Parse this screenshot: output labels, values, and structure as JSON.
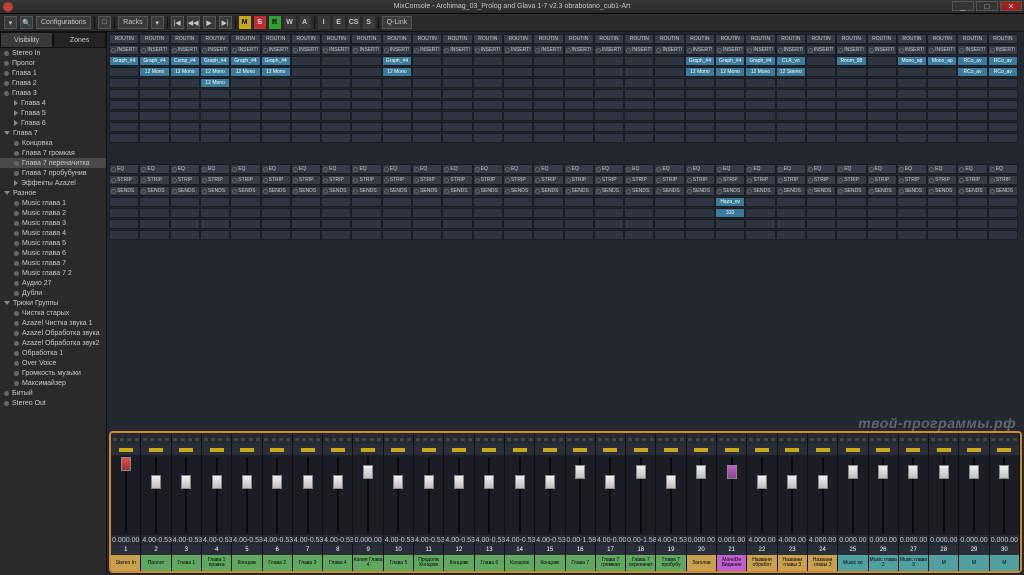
{
  "title": "MixConsole - Archimag_03_Prolog and Glava 1-7 v2.3 obrabotano_cub1-Art",
  "toolbar": {
    "config": "Configurations",
    "racks": "Racks",
    "qlink": "Q-Link"
  },
  "sidebar": {
    "tabs": [
      "Visibility",
      "Zones"
    ],
    "tracks": [
      {
        "name": "Stereo In",
        "dot": true
      },
      {
        "name": "Пролог",
        "dot": true
      },
      {
        "name": "Глава 1",
        "dot": true
      },
      {
        "name": "Глава 2",
        "dot": true
      },
      {
        "name": "Глава 3",
        "dot": true
      },
      {
        "name": "Глава 4",
        "tri": true,
        "indent": 1
      },
      {
        "name": "Глава 5",
        "tri": true,
        "indent": 1
      },
      {
        "name": "Глава 6",
        "tri": true,
        "indent": 1
      },
      {
        "name": "Глава 7",
        "tri": true,
        "open": true
      },
      {
        "name": "Концовка",
        "dot": true,
        "indent": 1
      },
      {
        "name": "Глава 7 громкая",
        "dot": true,
        "indent": 1
      },
      {
        "name": "Глава 7 переначитка",
        "dot": true,
        "indent": 1,
        "selected": true
      },
      {
        "name": "Глава 7 пробубунив",
        "dot": true,
        "indent": 1
      },
      {
        "name": "Эффекты Azazel",
        "tri": true,
        "indent": 1
      },
      {
        "name": "Разное",
        "tri": true,
        "open": true
      },
      {
        "name": "Music глава 1",
        "dot": true,
        "indent": 1
      },
      {
        "name": "Music глава 2",
        "dot": true,
        "indent": 1
      },
      {
        "name": "Music глава 3",
        "dot": true,
        "indent": 1
      },
      {
        "name": "Music глава 4",
        "dot": true,
        "indent": 1
      },
      {
        "name": "Music глава 5",
        "dot": true,
        "indent": 1
      },
      {
        "name": "Music глава 6",
        "dot": true,
        "indent": 1
      },
      {
        "name": "Music глава 7",
        "dot": true,
        "indent": 1
      },
      {
        "name": "Music глава 7 2",
        "dot": true,
        "indent": 1
      },
      {
        "name": "Аудио 27",
        "dot": true,
        "indent": 1
      },
      {
        "name": "Дубли",
        "dot": true,
        "indent": 1
      },
      {
        "name": "Трюки Группы",
        "tri": true,
        "open": true
      },
      {
        "name": "Чистка старых",
        "dot": true,
        "indent": 1
      },
      {
        "name": "Azazel Чистка звука 1",
        "dot": true,
        "indent": 1
      },
      {
        "name": "Azazel Обработка звука",
        "dot": true,
        "indent": 1
      },
      {
        "name": "Azazel Обработка звук2",
        "dot": true,
        "indent": 1
      },
      {
        "name": "Обработка 1",
        "dot": true,
        "indent": 1
      },
      {
        "name": "Over Voice",
        "dot": true,
        "indent": 1
      },
      {
        "name": "Громкость музыки",
        "dot": true,
        "indent": 1
      },
      {
        "name": "Максимайзер",
        "dot": true,
        "indent": 1
      },
      {
        "name": "Битый",
        "dot": true
      },
      {
        "name": "Stereo Out",
        "dot": true
      }
    ]
  },
  "rack": {
    "routin": "ROUTIN",
    "insert": "INSERT!",
    "eq": "EQ",
    "strip": "STRIP",
    "sends": "SENDS",
    "blueTop": [
      "Graph_#4",
      "Graph_#4",
      "Comp_#4",
      "Graph_#4",
      "Graph_#4",
      "Graph_#4",
      "",
      "",
      "",
      "Graph_#4",
      "",
      "",
      "",
      "",
      "",
      "",
      "",
      "",
      "",
      "Graph_#4",
      "Graph_#4",
      "Graph_#4",
      "CLA_vo",
      "",
      "Room_98",
      "",
      "Mono_ap",
      "Mono_ap",
      "RCo_av",
      "RCo_av"
    ],
    "blueBot": [
      "",
      "12 Mono",
      "12 Mono",
      "12 Mono",
      "12 Mono",
      "12 Mono",
      "",
      "",
      "",
      "12 Mono",
      "",
      "",
      "",
      "",
      "",
      "",
      "",
      "",
      "",
      "12 Mono",
      "12 Mono",
      "12 Mono",
      "12 Stereo",
      "",
      "",
      "",
      "",
      "",
      "RCo_av",
      "RCo_av"
    ],
    "blueThird": [
      "",
      "",
      "",
      "12 Mono",
      "",
      "",
      "",
      "",
      "",
      "",
      "",
      "",
      "",
      "",
      "",
      "",
      "",
      "",
      "",
      "",
      "",
      "",
      "",
      "",
      "",
      "",
      "",
      "",
      "",
      ""
    ],
    "sendSlot": {
      "idx": 20,
      "top": "Haza_ov",
      "bot": "310"
    }
  },
  "channels": [
    {
      "n": 1,
      "name": "Stereo In",
      "color": "#c9a050",
      "db": "0.00",
      "pan": "0.00",
      "fader": 0,
      "solo": true
    },
    {
      "n": 2,
      "name": "Пролог",
      "color": "#60a860",
      "db": "4.00",
      "pan": "-0.53",
      "fader": 18
    },
    {
      "n": 3,
      "name": "Глава 1",
      "color": "#60a860",
      "db": "4.00",
      "pan": "-0.53",
      "fader": 18
    },
    {
      "n": 4,
      "name": "Глава 1 правка",
      "color": "#60a860",
      "db": "4.00",
      "pan": "-0.53",
      "fader": 18
    },
    {
      "n": 5,
      "name": "Концовк",
      "color": "#60a860",
      "db": "4.00",
      "pan": "-0.53",
      "fader": 18
    },
    {
      "n": 6,
      "name": "Глава 2",
      "color": "#60a860",
      "db": "4.00",
      "pan": "-0.53",
      "fader": 18
    },
    {
      "n": 7,
      "name": "Глава 3",
      "color": "#60a860",
      "db": "4.00",
      "pan": "-0.53",
      "fader": 18
    },
    {
      "n": 8,
      "name": "Глава 4",
      "color": "#60a860",
      "db": "4.00",
      "pan": "-0.53",
      "fader": 18
    },
    {
      "n": 9,
      "name": "Копия Глава 4",
      "color": "#60a860",
      "db": "0.00",
      "pan": "0.00",
      "fader": 8
    },
    {
      "n": 10,
      "name": "Глава 5",
      "color": "#60a860",
      "db": "4.00",
      "pan": "-0.53",
      "fader": 18
    },
    {
      "n": 11,
      "name": "Продолж Концовк",
      "color": "#60a860",
      "db": "4.00",
      "pan": "-0.53",
      "fader": 18
    },
    {
      "n": 12,
      "name": "Концовк",
      "color": "#60a860",
      "db": "4.00",
      "pan": "-0.53",
      "fader": 18
    },
    {
      "n": 13,
      "name": "Глава 6",
      "color": "#60a860",
      "db": "4.00",
      "pan": "-0.53",
      "fader": 18
    },
    {
      "n": 14,
      "name": "Концовк",
      "color": "#60a860",
      "db": "4.00",
      "pan": "-0.53",
      "fader": 18
    },
    {
      "n": 15,
      "name": "Концовк",
      "color": "#60a860",
      "db": "4.00",
      "pan": "-0.53",
      "fader": 18
    },
    {
      "n": 16,
      "name": "Глава 7",
      "color": "#60a860",
      "db": "0.00",
      "pan": "-1.58",
      "fader": 8
    },
    {
      "n": 17,
      "name": "Глава 7 громкая",
      "color": "#60a860",
      "db": "4.00",
      "pan": "-0.00",
      "fader": 18
    },
    {
      "n": 18,
      "name": "Глава 7 переначит",
      "color": "#60a860",
      "db": "0.00",
      "pan": "-1.58",
      "fader": 8
    },
    {
      "n": 19,
      "name": "Глава 7 пробубу",
      "color": "#60a860",
      "db": "4.00",
      "pan": "-0.53",
      "fader": 18
    },
    {
      "n": 20,
      "name": "Заголов",
      "color": "#c9a050",
      "db": "0.00",
      "pan": "0.00",
      "fader": 8
    },
    {
      "n": 21,
      "name": "МоноDe Видание",
      "color": "#c060d0",
      "db": "0.00",
      "pan": "1.00",
      "fader": 8,
      "pk": true
    },
    {
      "n": 22,
      "name": "Названи обработ",
      "color": "#c9a050",
      "db": "4.00",
      "pan": "0.00",
      "fader": 18
    },
    {
      "n": 23,
      "name": "Названи главы 3",
      "color": "#c9a050",
      "db": "4.00",
      "pan": "0.00",
      "fader": 18
    },
    {
      "n": 24,
      "name": "Названи главы 3",
      "color": "#c9a050",
      "db": "4.00",
      "pan": "0.00",
      "fader": 18
    },
    {
      "n": 25,
      "name": "Music хо",
      "color": "#50a0a0",
      "db": "0.00",
      "pan": "0.00",
      "fader": 8
    },
    {
      "n": 26,
      "name": "Music глава 2",
      "color": "#50a0a0",
      "db": "0.00",
      "pan": "0.00",
      "fader": 8
    },
    {
      "n": 27,
      "name": "Music глава 3",
      "color": "#50a0a0",
      "db": "0.00",
      "pan": "0.00",
      "fader": 8
    },
    {
      "n": 28,
      "name": "M",
      "color": "#50a0a0",
      "db": "0.00",
      "pan": "0.00",
      "fader": 8
    },
    {
      "n": 29,
      "name": "М",
      "color": "#50a0a0",
      "db": "0.00",
      "pan": "0.00",
      "fader": 8
    },
    {
      "n": 30,
      "name": "М",
      "color": "#50a0a0",
      "db": "0.00",
      "pan": "0.00",
      "fader": 8
    }
  ],
  "watermark": "твой-программы.рф"
}
